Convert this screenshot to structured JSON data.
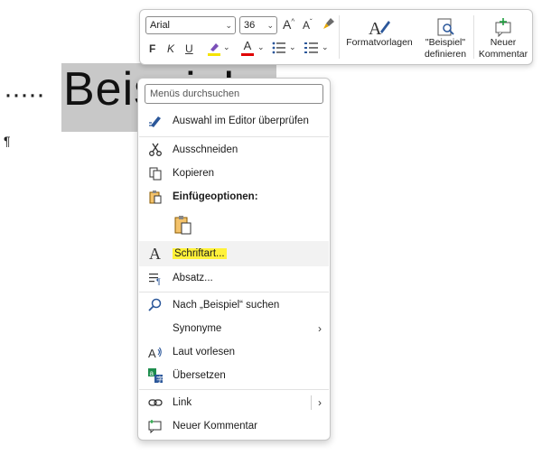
{
  "document": {
    "leading_dots": "·····",
    "word": "Beispiel",
    "pilcrow_after_word": "¶",
    "pilcrow": "¶"
  },
  "toolbar": {
    "font_name": "Arial",
    "font_size": "36",
    "grow_font": "A",
    "shrink_font": "A",
    "bold": "F",
    "italic": "K",
    "underline": "U",
    "font_color_letter": "A",
    "highlight_color": "#f5e400",
    "font_color": "#e00000",
    "styles_label": "Formatvorlagen",
    "define_label_line1": "\"Beispiel\"",
    "define_label_line2": "definieren",
    "comment_label_line1": "Neuer",
    "comment_label_line2": "Kommentar"
  },
  "menu": {
    "search_placeholder": "Menüs durchsuchen",
    "items": {
      "check_editor": "Auswahl im Editor überprüfen",
      "cut": "Ausschneiden",
      "copy": "Kopieren",
      "paste_options": "Einfügeoptionen:",
      "font": "Schriftart...",
      "paragraph": "Absatz...",
      "search": "Nach „Beispiel“ suchen",
      "synonyms": "Synonyme",
      "read_aloud": "Laut vorlesen",
      "translate": "Übersetzen",
      "link": "Link",
      "new_comment": "Neuer Kommentar"
    },
    "submenu_arrow": "›",
    "accent_color": "#2b579a",
    "highlight_color": "#fff23a"
  }
}
